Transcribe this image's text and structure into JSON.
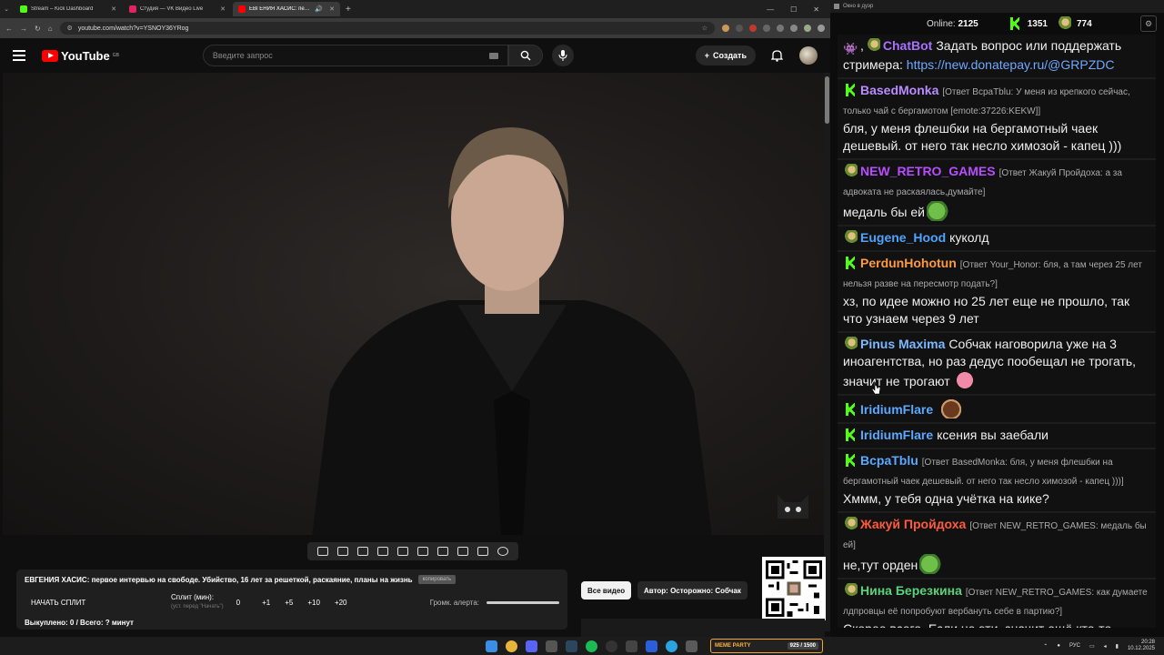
{
  "browser": {
    "tabs": [
      {
        "title": "Stream – Kick Dashboard",
        "color": "#53fc18",
        "active": false
      },
      {
        "title": "Студия — VK Видео Live",
        "color": "#e0245e",
        "active": false
      },
      {
        "title": "ЕВГЕНИЯ ХАСИС: первое",
        "color": "#ff0000",
        "active": true
      }
    ],
    "url": "youtube.com/watch?v=YSNOY36YRog"
  },
  "youtube": {
    "logo_text": "YouTube",
    "region": "GB",
    "search_placeholder": "Введите запрос",
    "create_label": "Создать"
  },
  "panel": {
    "video_title": "ЕВГЕНИЯ ХАСИС: первое интервью на свободе. Убийство, 16 лет за решеткой, раскаяние, планы на жизнь",
    "copy_label": "копировать",
    "start_split": "НАЧАТЬ СПЛИТ",
    "split_label": "Сплит (мин):",
    "split_hint": "(уст. перед \"Начать\")",
    "split_values": [
      "0",
      "+1",
      "+5",
      "+10",
      "+20"
    ],
    "volume_label": "Громк. алерта:",
    "volume_level": 1.0,
    "status": "Выкуплено: 0 / Всего: ? минут"
  },
  "channel": {
    "all_videos": "Все видео",
    "author": "Автор: Осторожно: Собчак"
  },
  "chat": {
    "window_title": "Окно в дуэр",
    "online_label": "Online:",
    "online_value": "2125",
    "kick_count": "1351",
    "other_count": "774",
    "messages": [
      {
        "badges": [
          "bot",
          "pepe"
        ],
        "nick": "ChatBot",
        "color": "#a970ff",
        "reply": "",
        "text": "Задать вопрос или поддержать стримера: ",
        "link": "https://new.donatepay.ru/@GRPZDC",
        "emote": ""
      },
      {
        "badges": [
          "kick"
        ],
        "nick": "BasedMonka",
        "color": "#b98cff",
        "reply": "[Ответ ВсраТblu: У меня из крепкого сейчас, только чай с бергамотом [emote:37226:KEKW]]",
        "text": "бля, у меня флешбки на бергамотный чаек дешевый. от него так несло химозой - капец )))",
        "link": "",
        "emote": ""
      },
      {
        "badges": [
          "pepe"
        ],
        "nick": "NEW_RETRO_GAMES",
        "color": "#b84dff",
        "reply": "[Ответ Жакуй Пройдоха: а за адвоката не раскаялась,думайте]",
        "text": "медаль бы ей",
        "link": "",
        "emote": "pepe"
      },
      {
        "badges": [
          "pepe"
        ],
        "nick": "Eugene_Hood",
        "color": "#4da3ff",
        "reply": "",
        "text": "куколд",
        "link": "",
        "emote": ""
      },
      {
        "badges": [
          "kick"
        ],
        "nick": "PerdunHohotun",
        "color": "#ff9a3c",
        "reply": "[Ответ Your_Honor: бля, а там через 25 лет нельзя разве на пересмотр подать?]",
        "text": "хз, по идее можно но 25 лет еще не прошло, так что узнаем через 9 лет",
        "link": "",
        "emote": ""
      },
      {
        "badges": [
          "pepe"
        ],
        "nick": "Pinus Maxima",
        "color": "#7ab8ff",
        "reply": "",
        "text": "Собчак наговорила уже на 3 иноагентства, но раз дедус пообещал не трогать, значит не трогают",
        "link": "",
        "emote": "pink"
      },
      {
        "badges": [
          "kick"
        ],
        "nick": "IridiumFlare",
        "color": "#5aa9ff",
        "reply": "",
        "text": "",
        "link": "",
        "emote": "face"
      },
      {
        "badges": [
          "kick"
        ],
        "nick": "IridiumFlare",
        "color": "#5aa9ff",
        "reply": "",
        "text": "ксения вы заебали",
        "link": "",
        "emote": ""
      },
      {
        "badges": [
          "kick"
        ],
        "nick": "ВсраТblu",
        "color": "#5aa9ff",
        "reply": "[Ответ BasedMonka: бля, у меня флешбки на бергамотный чаек дешевый. от него так несло химозой - капец )))]",
        "text": "Хммм, у тебя одна учётка на кике?",
        "link": "",
        "emote": ""
      },
      {
        "badges": [
          "pepe"
        ],
        "nick": "Жакуй Пройдоха",
        "color": "#ff5a3c",
        "reply": "[Ответ NEW_RETRO_GAMES: медаль бы ей]",
        "text": "не,тут орден",
        "link": "",
        "emote": "pepe"
      },
      {
        "badges": [
          "pepe"
        ],
        "nick": "Нина Березкина",
        "color": "#5ad17a",
        "reply": "[Ответ NEW_RETRO_GAMES: как думаете лдпровцы её попробуют вербануть себе в партию?]",
        "text": "Скорее всего. Если не эти, значит ещё кто-то.",
        "link": "",
        "emote": ""
      }
    ]
  },
  "taskbar": {
    "meme_label": "MEME PARTY",
    "meme_count": "925 / 1500",
    "lang": "РУС",
    "time": "20:28",
    "date": "10.12.2025"
  },
  "colors": {
    "kick_green": "#53fc18",
    "yt_red": "#ff0000",
    "link_blue": "#6fa8ff"
  }
}
